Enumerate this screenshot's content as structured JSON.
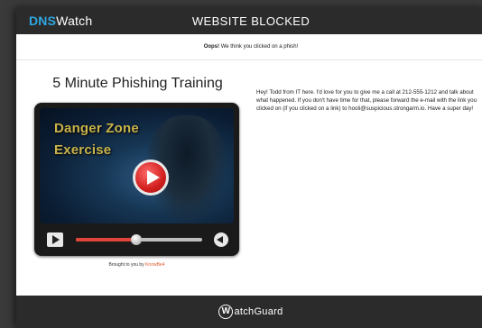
{
  "header": {
    "brand_dns": "DNS",
    "brand_watch": "Watch",
    "title": "WEBSITE BLOCKED"
  },
  "notice": {
    "bold": "Oops!",
    "text": " We think you clicked on a phish!"
  },
  "training": {
    "title": "5 Minute Phishing Training",
    "video_line1": "Danger Zone",
    "video_line2": "Exercise",
    "progress_fraction": 0.48
  },
  "credit": {
    "prefix": "Brought to you by ",
    "link": "KnowBe4"
  },
  "message": "Hey! Todd from IT here. I'd love for you to give me a call at 212-555-1212 and talk about what happened. If you don't have time for that, please forward the e-mail with the link you clicked on (if you clicked on a link) to hooli@suspicious.strongarm.io. Have a super day!",
  "footer": {
    "logo_letter": "W",
    "logo_text": "atchGuard"
  },
  "colors": {
    "brand_blue": "#2ea7e0",
    "bar_dark": "#2b2b2b",
    "accent_red": "#e0443a",
    "video_text": "#c9b34a"
  },
  "icons": [
    "play-icon",
    "volume-icon",
    "play-button-icon"
  ]
}
